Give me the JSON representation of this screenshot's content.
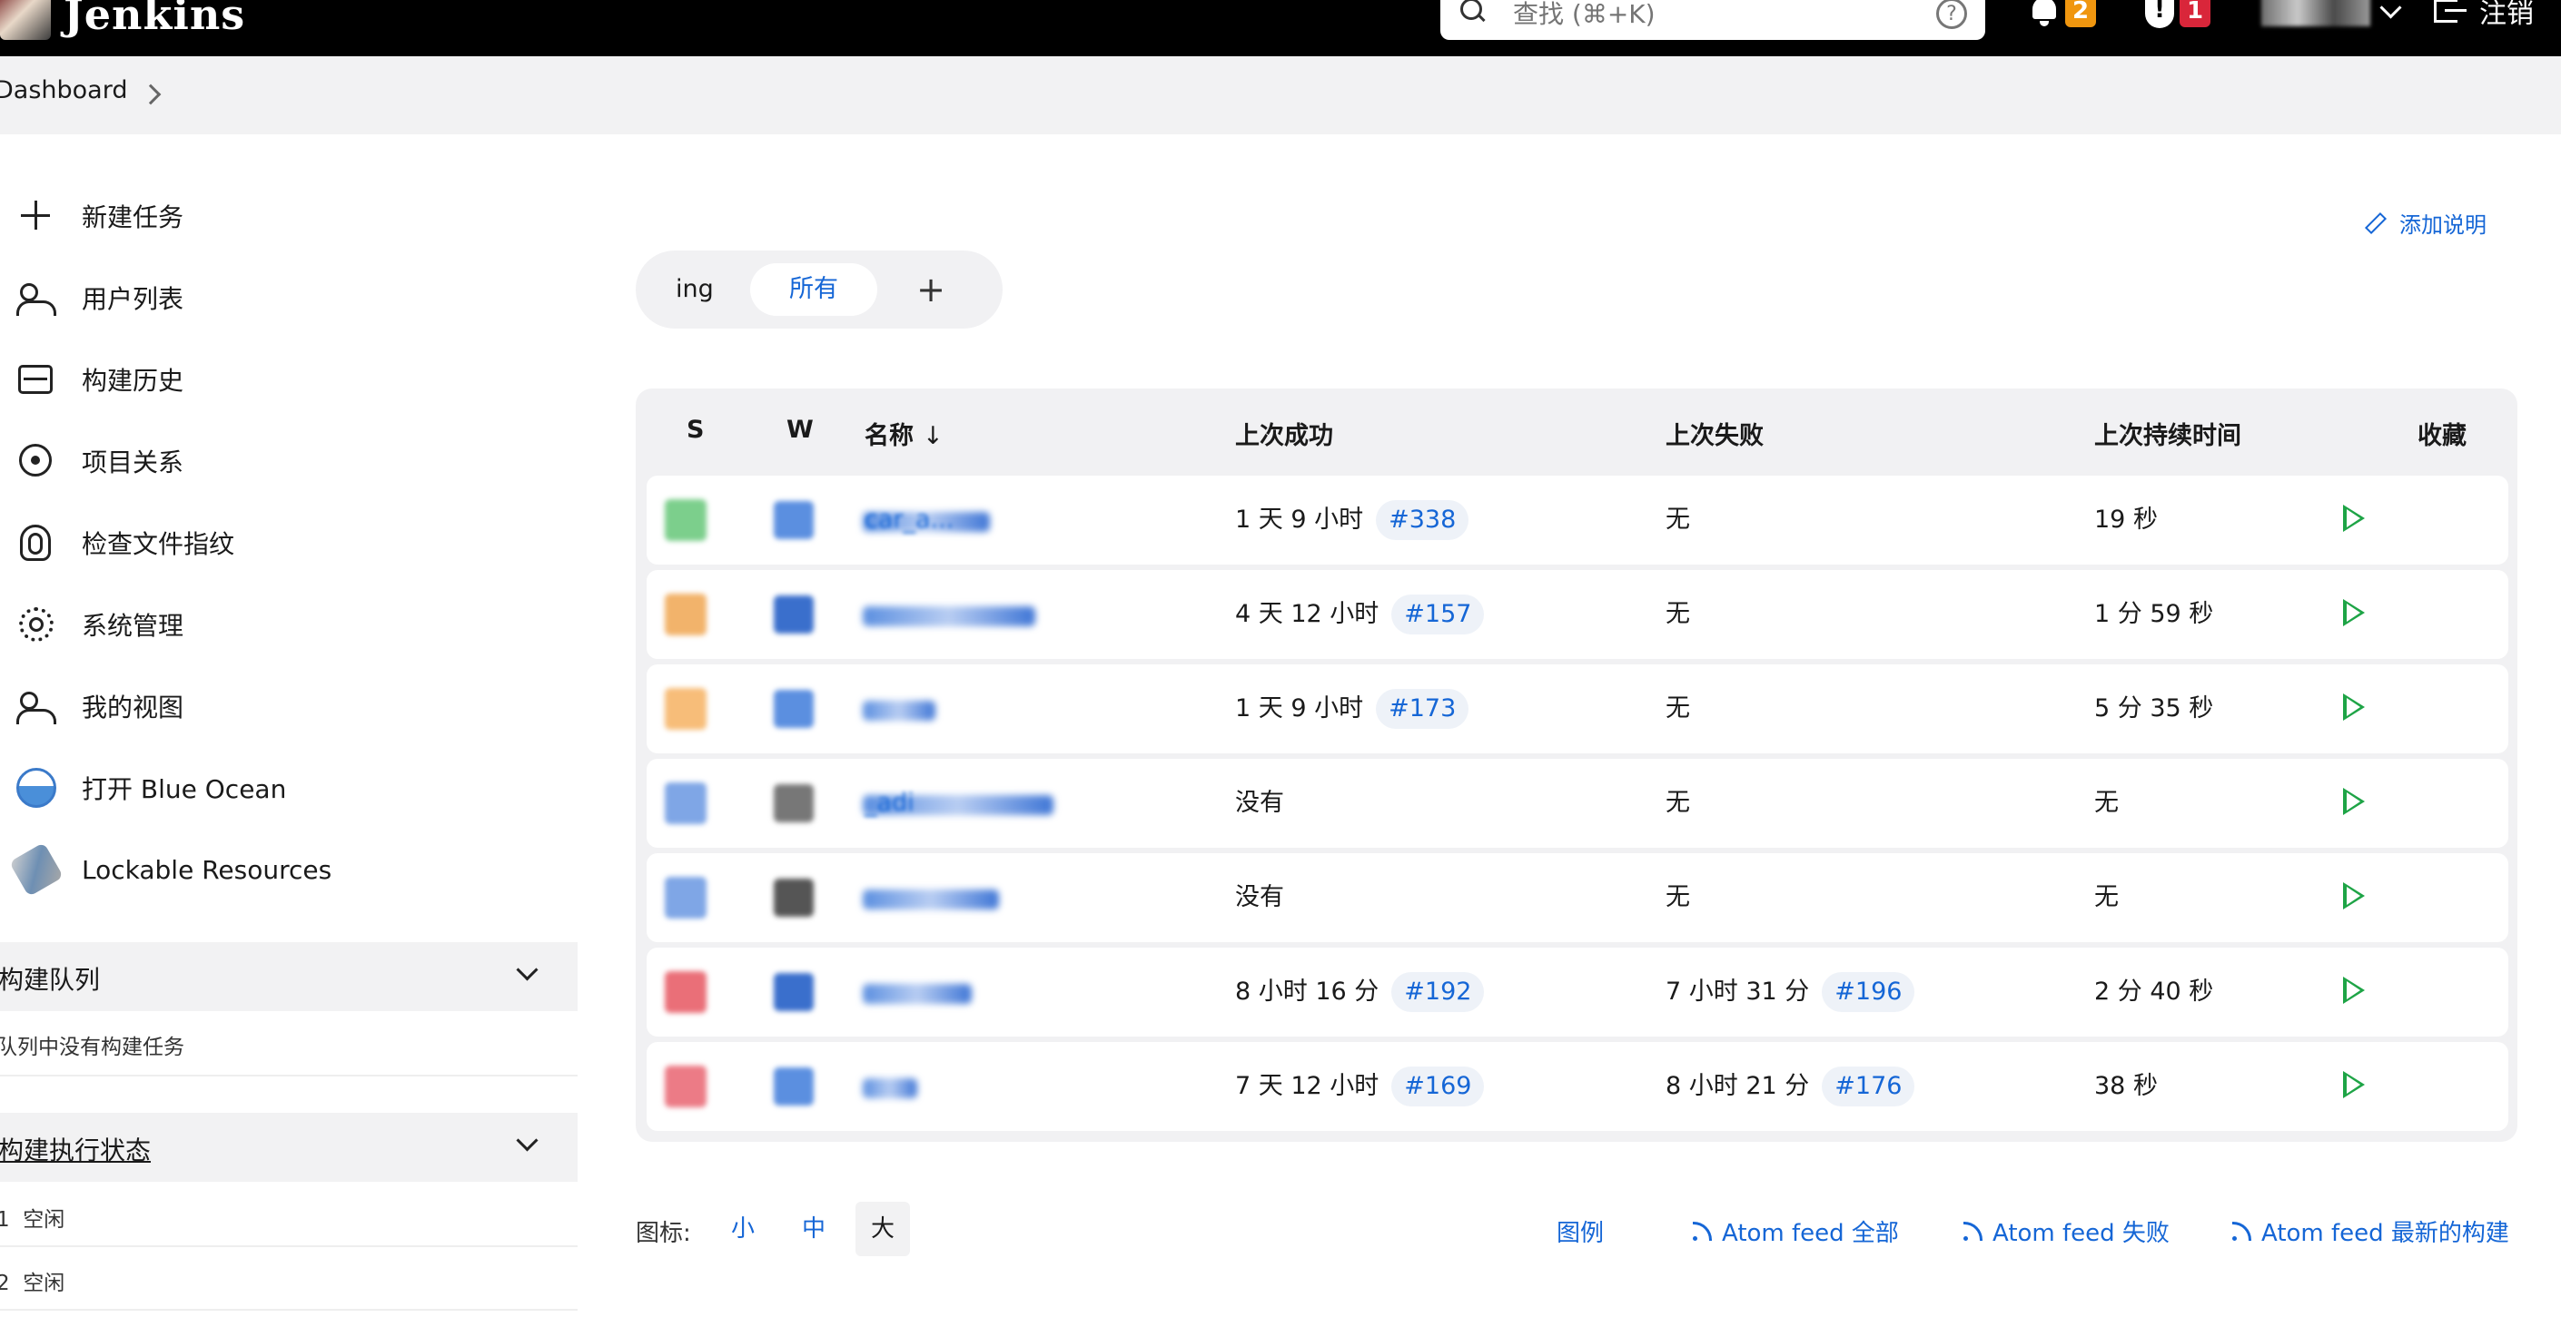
{
  "header": {
    "logo_text": "Jenkins",
    "search_placeholder": "查找 (⌘+K)",
    "notifications_count": "2",
    "security_count": "1",
    "logout_label": "注销"
  },
  "breadcrumb": {
    "item": "Dashboard"
  },
  "sidebar": {
    "items": [
      {
        "label": "新建任务",
        "icon": "plus-icon"
      },
      {
        "label": "用户列表",
        "icon": "users-icon"
      },
      {
        "label": "构建历史",
        "icon": "history-icon"
      },
      {
        "label": "项目关系",
        "icon": "relationship-icon"
      },
      {
        "label": "检查文件指纹",
        "icon": "fingerprint-icon"
      },
      {
        "label": "系统管理",
        "icon": "gear-icon"
      },
      {
        "label": "我的视图",
        "icon": "users-icon"
      },
      {
        "label": "打开 Blue Ocean",
        "icon": "blue-ocean-icon"
      },
      {
        "label": "Lockable Resources",
        "icon": "lock-icon"
      }
    ],
    "build_queue": {
      "title": "构建队列",
      "empty_text": "队列中没有构建任务"
    },
    "executors": {
      "title": "构建执行状态",
      "rows": [
        {
          "num": "1",
          "status": "空闲"
        },
        {
          "num": "2",
          "status": "空闲"
        }
      ]
    }
  },
  "main": {
    "add_description": "添加说明",
    "tabs": {
      "first": "ing",
      "active": "所有",
      "add": "+"
    },
    "table": {
      "headers": {
        "s": "S",
        "w": "W",
        "name": "名称",
        "sort": "↓",
        "last_success": "上次成功",
        "last_failure": "上次失败",
        "last_duration": "上次持续时间",
        "fav": "收藏"
      },
      "rows": [
        {
          "name": "car_a...",
          "last_success": "1 天 9 小时",
          "success_build": "#338",
          "last_failure": "无",
          "failure_build": "",
          "duration": "19 秒",
          "status_color": "#7ccf8c",
          "weather_color": "#5b8fe0"
        },
        {
          "name": "",
          "last_success": "4 天 12 小时",
          "success_build": "#157",
          "last_failure": "无",
          "failure_build": "",
          "duration": "1 分 59 秒",
          "status_color": "#f2b36b",
          "weather_color": "#3a6fcc"
        },
        {
          "name": "",
          "last_success": "1 天 9 小时",
          "success_build": "#173",
          "last_failure": "无",
          "failure_build": "",
          "duration": "5 分 35 秒",
          "status_color": "#f7bd79",
          "weather_color": "#5b8fe0"
        },
        {
          "name": "_adi",
          "last_success": "没有",
          "success_build": "",
          "last_failure": "无",
          "failure_build": "",
          "duration": "无",
          "status_color": "#7fa6e6",
          "weather_color": "#777777"
        },
        {
          "name": "",
          "last_success": "没有",
          "success_build": "",
          "last_failure": "无",
          "failure_build": "",
          "duration": "无",
          "status_color": "#7fa6e6",
          "weather_color": "#555555"
        },
        {
          "name": "",
          "last_success": "8 小时 16 分",
          "success_build": "#192",
          "last_failure": "7 小时 31 分",
          "failure_build": "#196",
          "duration": "2 分 40 秒",
          "status_color": "#ea6f78",
          "weather_color": "#3a6fcc"
        },
        {
          "name": "",
          "last_success": "7 天 12 小时",
          "success_build": "#169",
          "last_failure": "8 小时 21 分",
          "failure_build": "#176",
          "duration": "38 秒",
          "status_color": "#ec7b86",
          "weather_color": "#5b8fe0"
        }
      ]
    },
    "footer": {
      "icons_label": "图标:",
      "size_small": "小",
      "size_medium": "中",
      "size_large": "大",
      "legend": "图例",
      "feed_all": "Atom feed 全部",
      "feed_fail": "Atom feed 失败",
      "feed_latest": "Atom feed 最新的构建"
    }
  }
}
